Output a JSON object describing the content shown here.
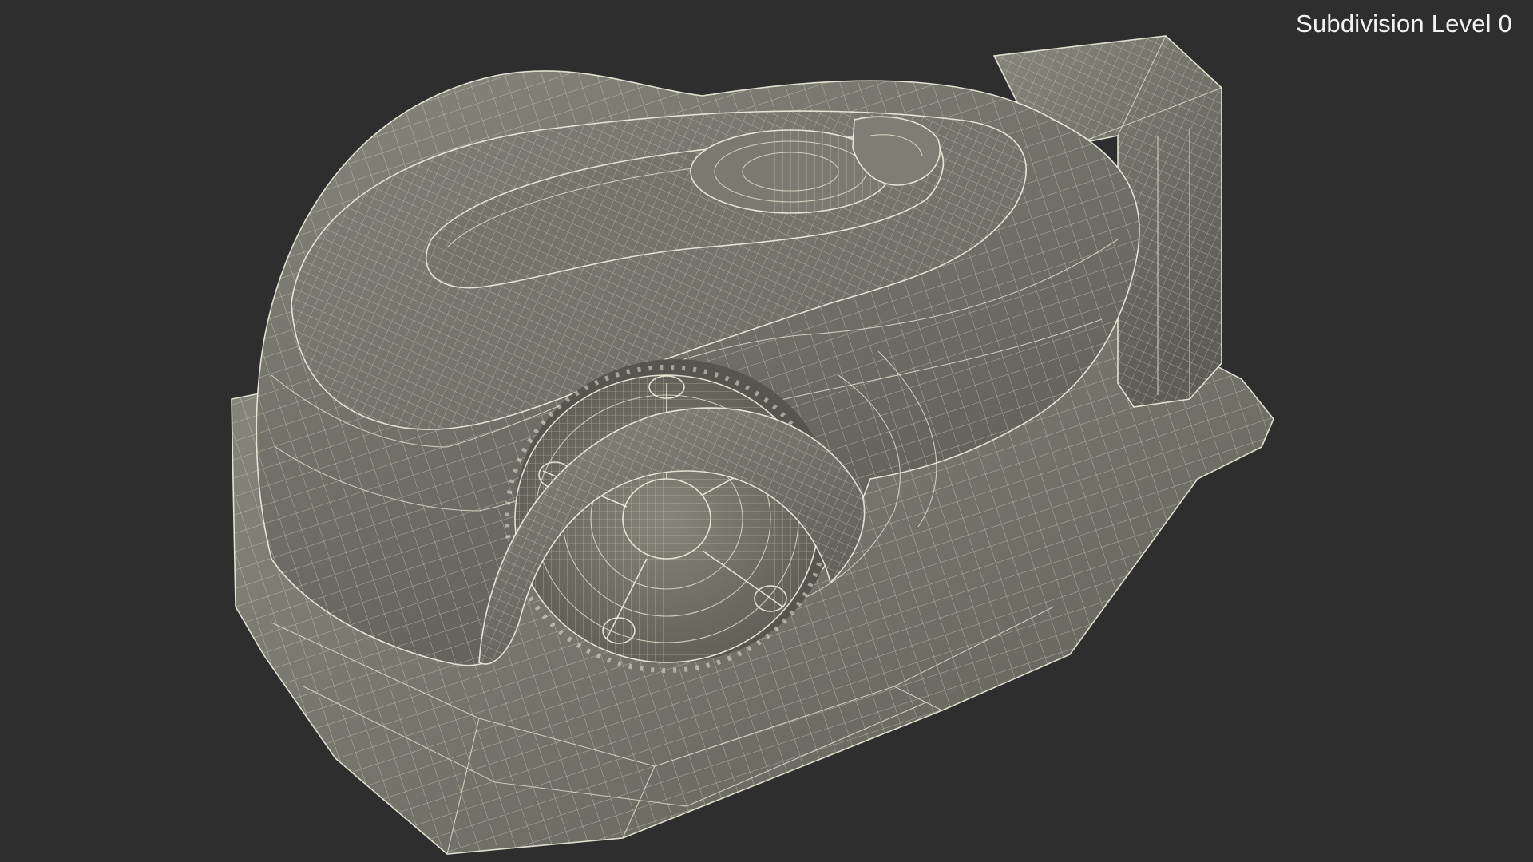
{
  "viewport": {
    "caption": "Subdivision Level 0",
    "background_color": "#2e2e2e",
    "mesh_fill_color": "#7c7c72",
    "wire_color": "#e6e8d2"
  },
  "model": {
    "icons": [
      "wireframe-mesh"
    ]
  }
}
